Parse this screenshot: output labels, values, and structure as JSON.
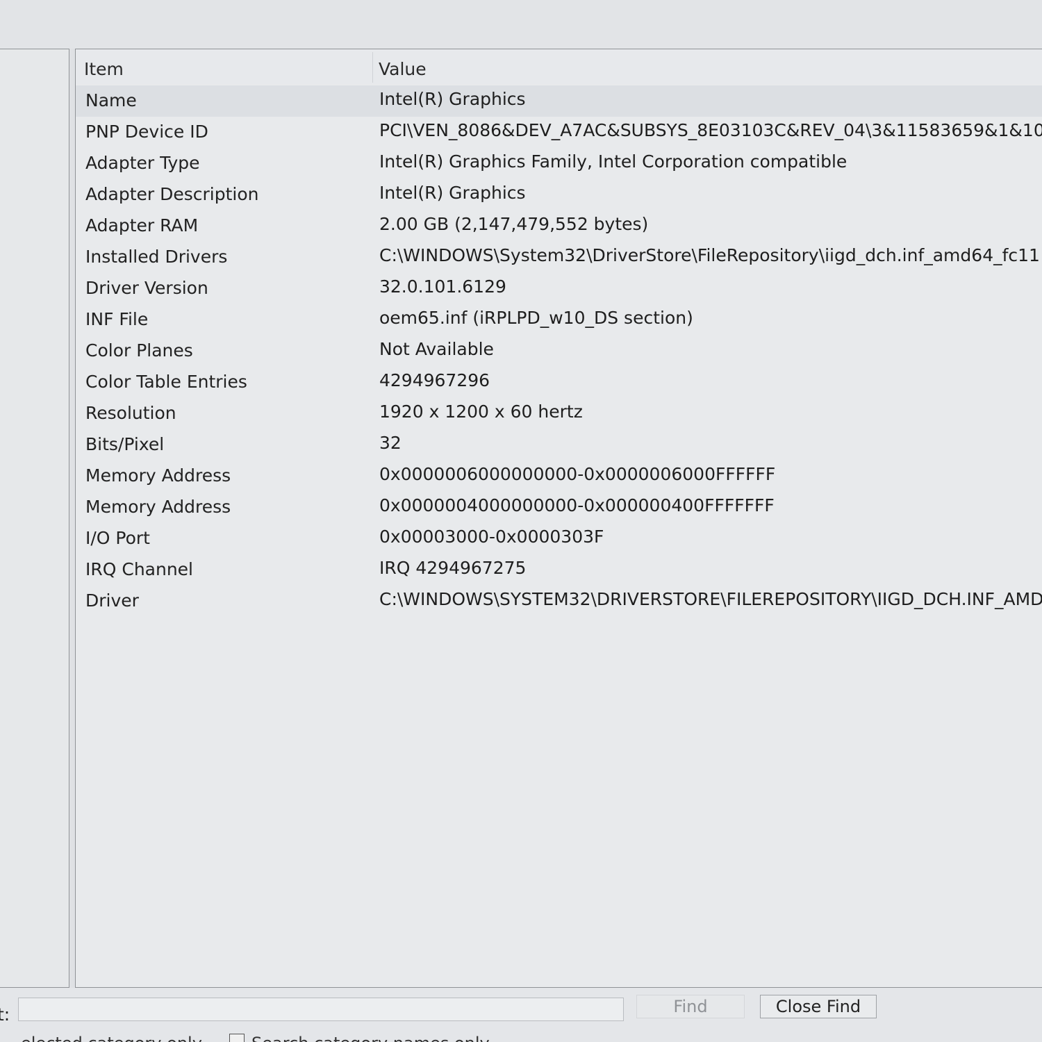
{
  "columns": {
    "item": "Item",
    "value": "Value"
  },
  "rows": [
    {
      "item": "Name",
      "value": "Intel(R) Graphics"
    },
    {
      "item": "PNP Device ID",
      "value": "PCI\\VEN_8086&DEV_A7AC&SUBSYS_8E03103C&REV_04\\3&11583659&1&10"
    },
    {
      "item": "Adapter Type",
      "value": "Intel(R) Graphics Family, Intel Corporation compatible"
    },
    {
      "item": "Adapter Description",
      "value": "Intel(R) Graphics"
    },
    {
      "item": "Adapter RAM",
      "value": "2.00 GB (2,147,479,552 bytes)"
    },
    {
      "item": "Installed Drivers",
      "value": "C:\\WINDOWS\\System32\\DriverStore\\FileRepository\\iigd_dch.inf_amd64_fc11"
    },
    {
      "item": "Driver Version",
      "value": "32.0.101.6129"
    },
    {
      "item": "INF File",
      "value": "oem65.inf (iRPLPD_w10_DS section)"
    },
    {
      "item": "Color Planes",
      "value": "Not Available"
    },
    {
      "item": "Color Table Entries",
      "value": "4294967296"
    },
    {
      "item": "Resolution",
      "value": "1920 x 1200 x 60 hertz"
    },
    {
      "item": "Bits/Pixel",
      "value": "32"
    },
    {
      "item": "Memory Address",
      "value": "0x0000006000000000-0x0000006000FFFFFF"
    },
    {
      "item": "Memory Address",
      "value": "0x0000004000000000-0x000000400FFFFFFF"
    },
    {
      "item": "I/O Port",
      "value": "0x00003000-0x0000303F"
    },
    {
      "item": "IRQ Channel",
      "value": "IRQ 4294967275"
    },
    {
      "item": "Driver",
      "value": "C:\\WINDOWS\\SYSTEM32\\DRIVERSTORE\\FILEREPOSITORY\\IIGD_DCH.INF_AMD"
    }
  ],
  "find_bar": {
    "label": "t:",
    "search_value": "",
    "find_label": "Find",
    "close_find_label": "Close Find",
    "option_text": "elected category only",
    "checkbox_label": "Search category names only"
  }
}
